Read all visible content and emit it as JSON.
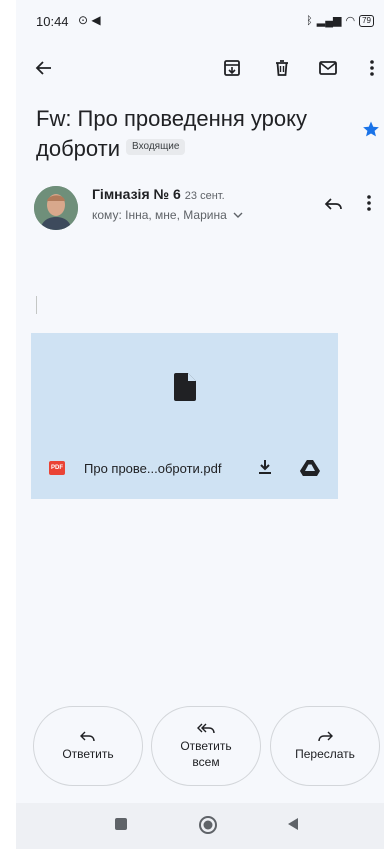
{
  "status": {
    "time": "10:44",
    "battery": "79"
  },
  "email": {
    "subject": "Fw: Про проведення уроку доброти",
    "label": "Входящие",
    "sender": "Гімназія № 6",
    "date": "23 сент.",
    "recipients": "кому: Інна, мне, Марина",
    "attachment": {
      "name": "Про прове...оброти.pdf",
      "type": "PDF"
    }
  },
  "actions": {
    "reply": "Ответить",
    "reply_all": "Ответить всем",
    "forward": "Переслать"
  },
  "icons": [
    "back-arrow-icon",
    "archive-icon",
    "trash-icon",
    "mail-icon",
    "more-vert-icon",
    "star-icon",
    "reply-icon",
    "file-icon",
    "pdf-icon",
    "download-icon",
    "drive-icon",
    "reply-all-icon",
    "forward-icon"
  ],
  "colors": {
    "background": "#f6f8fc",
    "attachment_bg": "#cfe2f3",
    "star": "#1a73e8",
    "pdf": "#ea4335"
  }
}
